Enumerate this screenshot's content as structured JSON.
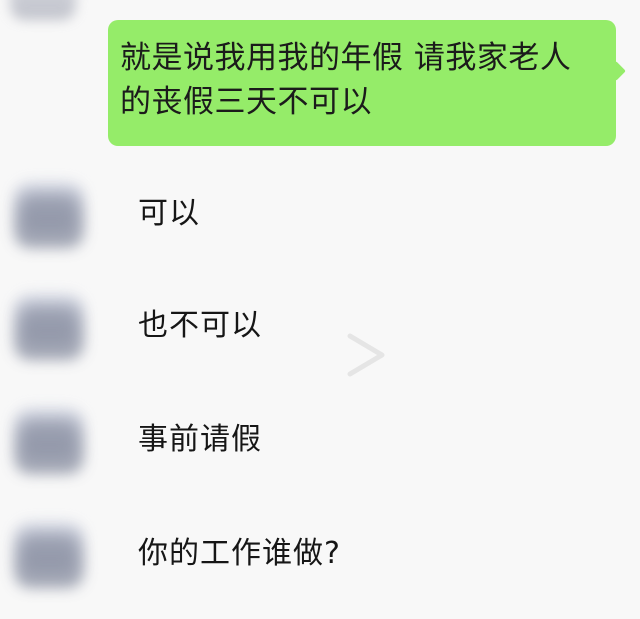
{
  "sent_message": {
    "text": "就是说我用我的年假 请我家老人的丧假三天不可以"
  },
  "received_messages": [
    {
      "text": "可以"
    },
    {
      "text": "也不可以"
    },
    {
      "text": "事前请假"
    },
    {
      "text": "你的工作谁做?"
    }
  ],
  "colors": {
    "sent_bubble": "#95ec69",
    "background": "#f8f8f8"
  },
  "icons": {
    "overlay": "play-icon",
    "avatar": "avatar"
  }
}
